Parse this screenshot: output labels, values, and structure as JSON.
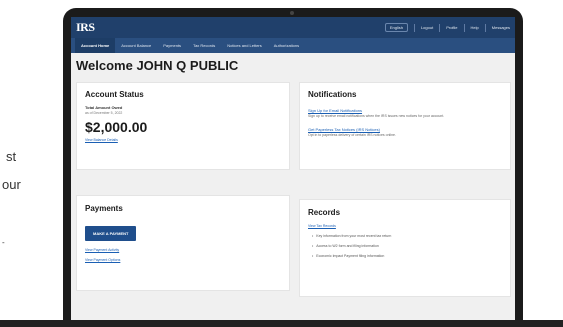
{
  "side_text": {
    "line1": "st",
    "line2": "our",
    "line3": "-"
  },
  "header": {
    "logo": "IRS",
    "language": "English",
    "login": "Logout",
    "profile": "Profile",
    "help": "Help",
    "messages": "Messages"
  },
  "nav": {
    "items": [
      {
        "label": "Account Home",
        "active": true
      },
      {
        "label": "Account Balance",
        "active": false
      },
      {
        "label": "Payments",
        "active": false
      },
      {
        "label": "Tax Records",
        "active": false
      },
      {
        "label": "Notices and Letters",
        "active": false
      },
      {
        "label": "Authorizations",
        "active": false
      }
    ]
  },
  "page": {
    "title": "Welcome JOHN Q PUBLIC"
  },
  "account_status": {
    "title": "Account Status",
    "subtitle": "Total Amount Owed",
    "as_of": "as of December 5, 2022",
    "balance": "$2,000.00",
    "link": "View Balance Details"
  },
  "notifications": {
    "title": "Notifications",
    "items": [
      {
        "link": "Sign Up for Email Notifications",
        "text": "Sign up to receive email notifications when the IRS issues new notices for your account."
      },
      {
        "link": "Get Paperless Tax Notices (IRS Notices)",
        "text": "Opt in to paperless delivery of certain IRS notices online."
      }
    ]
  },
  "payments": {
    "title": "Payments",
    "button": "MAKE A PAYMENT",
    "links": [
      "View Payment Activity",
      "View Payment Options"
    ]
  },
  "records": {
    "title": "Records",
    "link": "View Tax Records",
    "bullets": [
      "Key information from your most recent tax return",
      "Access to W2 form and filing information",
      "Economic Impact Payment filing information"
    ]
  }
}
